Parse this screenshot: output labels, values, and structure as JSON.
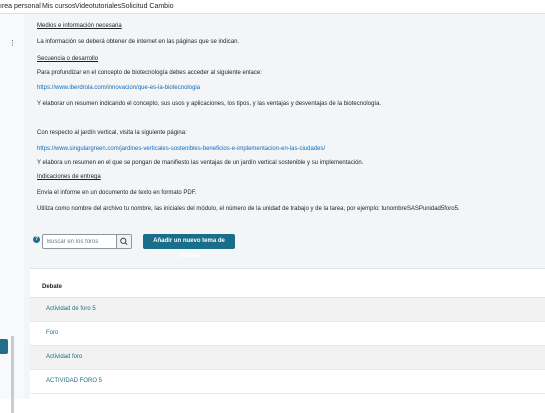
{
  "topnav": {
    "items": [
      "Área personal",
      "Mis cursos",
      "Videotutoriales",
      "Solicitud Cambio"
    ],
    "visible_first": "ırea personal"
  },
  "leftbar": {
    "menu_icon": "vertical-ellipsis-icon"
  },
  "content": {
    "lines": [
      "Medios e información necesaria",
      "La información se deberá obtener de internet en las páginas que se indican.",
      "Secuencia o desarrollo",
      "Para profundizar en el concepto de biotecnología debes acceder al siguiente enlace:",
      "https://www.iberdrola.com/innovacion/que-es-la-biotecnologia",
      "Y elaborar un resumen indicando el concepto, sus usos y aplicaciones, los tipos, y las ventajas y desventajas de la biotecnología.",
      "Con respecto al jardín vertical, visita la siguiente página:",
      "https://www.singulargreen.com/jardines-verticales-sostenibles-beneficios-e-implementacion-en-las-ciudades/",
      "Y elabora un resumen en el que se pongan de manifiesto las ventajas de un jardín vertical sostenible y su implementación.",
      "Indicaciones de entrega",
      "Envía el informe en un documento de texto en formato PDF.",
      "Utiliza como nombre del archivo tu nombre, las iniciales del módulo, el número de la unidad de trabajo y de la tarea, por ejemplo: tunombreSASPunidad5foro5."
    ]
  },
  "search": {
    "placeholder": "Buscar en los foros",
    "icon": "search-icon"
  },
  "help_icon": "question-circle-icon",
  "add_button": "Añadir un nuevo tema de debate",
  "table": {
    "header": "Debate",
    "rows": [
      "Actividad de foro 5",
      "Foro",
      "Actividad foro",
      "ACTIVIDAD FORO 5"
    ]
  },
  "colors": {
    "accent": "#1a6e8a",
    "link": "#0f6cbf"
  }
}
